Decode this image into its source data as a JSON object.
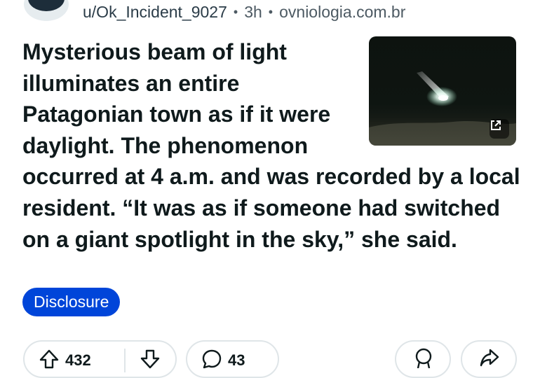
{
  "post": {
    "author": "u/Ok_Incident_9027",
    "separator": "•",
    "age": "3h",
    "domain": "ovniologia.com.br",
    "title": "Mysterious beam of light illuminates an entire Patagonian town as if it were daylight. The phenomenon occurred at 4 a.m. and was recorded by a local resident. “It was as if someone had switched on a giant spotlight in the sky,” she said.",
    "flair": "Disclosure",
    "flair_color": "#0045d9",
    "thumbnail_icon": "external-link-icon"
  },
  "actions": {
    "upvote_count": "432",
    "comment_count": "43",
    "icons": [
      "upvote-icon",
      "downvote-icon",
      "comment-icon",
      "award-icon",
      "share-icon"
    ]
  }
}
